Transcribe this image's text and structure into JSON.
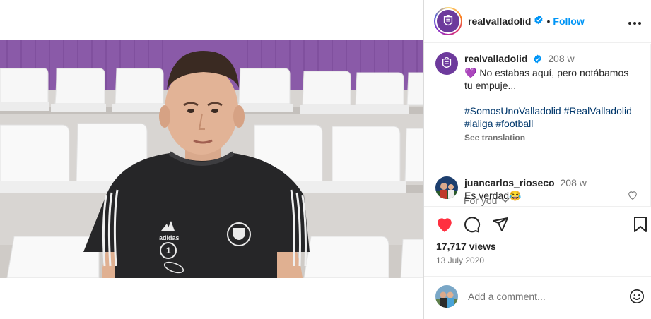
{
  "post": {
    "author": "realvalladolid",
    "follow_label": "Follow",
    "dot": "•",
    "more_icon": "more-horizontal-icon"
  },
  "caption": {
    "username": "realvalladolid",
    "time": "208 w",
    "heart": "💜",
    "text": "No estabas aquí, pero notábamos tu empuje...",
    "hashtags": [
      "#SomosUnoValladolid",
      "#RealValladolid",
      "#laliga",
      "#football"
    ],
    "see_translation": "See translation"
  },
  "for_you": {
    "label": "For you"
  },
  "comment": {
    "username": "juancarlos_rioseco",
    "time": "208 w",
    "text": "Es verdad😂"
  },
  "stats": {
    "views": "17,717 views",
    "date": "13 July 2020"
  },
  "add_comment": {
    "placeholder": "Add a comment..."
  },
  "colors": {
    "accent": "#0095f6",
    "like": "#ff3040",
    "hashtag": "#00376b",
    "club_purple": "#6d3a9c",
    "muted": "#737373"
  },
  "video": {
    "sound_state": "muted",
    "jersey_number": "1",
    "jersey_brand": "adidas"
  }
}
